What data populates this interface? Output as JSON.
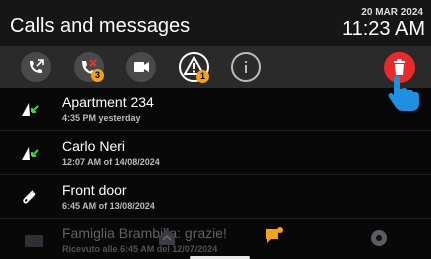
{
  "header": {
    "title": "Calls and messages",
    "date": "20 MAR 2024",
    "time": "11:23 AM"
  },
  "toolbar": {
    "missed_calls_badge": "3",
    "alarms_badge": "1",
    "icons": [
      "call-transfer-icon",
      "missed-call-icon",
      "video-icon",
      "alarm-icon",
      "info-icon",
      "trash-icon"
    ],
    "accent_red": "#ea2a2a",
    "badge_color": "#f5a21b"
  },
  "list": [
    {
      "name": "Apartment 234",
      "when": "4:35 PM yesterday",
      "icon": "answered-call-icon"
    },
    {
      "name": "Carlo Neri",
      "when": "12:07 AM of 14/08/2024",
      "icon": "answered-call-icon"
    },
    {
      "name": "Front door",
      "when": "6:45 AM of 13/08/2024",
      "icon": "paperclip-icon"
    },
    {
      "name": "Famiglia Brambilla: grazie!",
      "when": "Ricevuto alle 6:45 AM del 12/07/2024",
      "icon": "envelope-icon"
    }
  ],
  "nav": {
    "icons": [
      "mail-icon",
      "home-icon",
      "messages-icon",
      "settings-icon"
    ],
    "active_color": "#f5a21b"
  }
}
